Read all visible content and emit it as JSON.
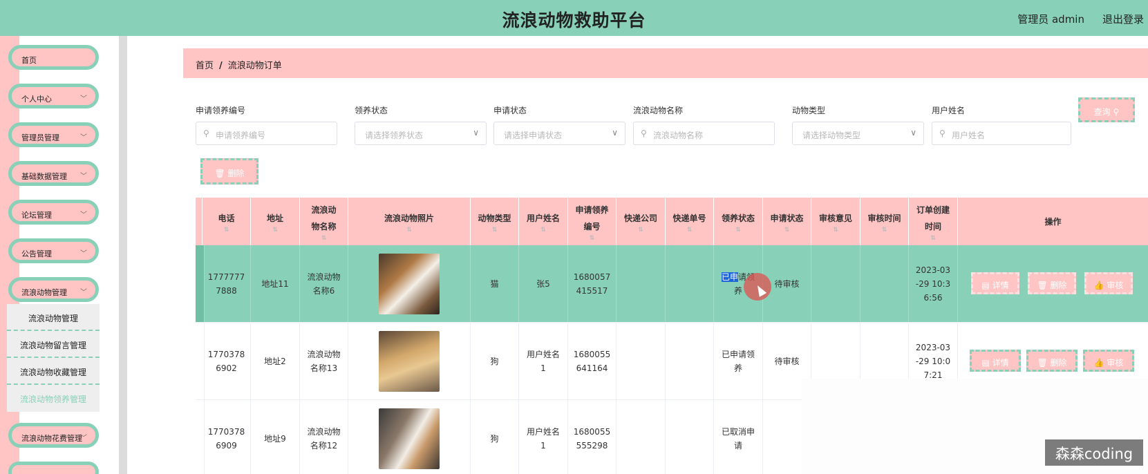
{
  "header": {
    "title": "流浪动物救助平台",
    "admin": "管理员 admin",
    "logout": "退出登录"
  },
  "sidebar": {
    "items": [
      {
        "label": "首页"
      },
      {
        "label": "个人中心"
      },
      {
        "label": "管理员管理"
      },
      {
        "label": "基础数据管理"
      },
      {
        "label": "论坛管理"
      },
      {
        "label": "公告管理"
      },
      {
        "label": "流浪动物管理"
      },
      {
        "label": "流浪动物花费管理"
      }
    ],
    "submenu": [
      "流浪动物管理",
      "流浪动物留言管理",
      "流浪动物收藏管理",
      "流浪动物领养管理"
    ]
  },
  "breadcrumb": {
    "home": "首页",
    "sep": "/",
    "current": "流浪动物订单"
  },
  "search": {
    "fields": [
      {
        "label": "申请领养编号",
        "placeholder": "申请领养编号"
      },
      {
        "label": "领养状态",
        "placeholder": "请选择领养状态"
      },
      {
        "label": "申请状态",
        "placeholder": "请选择申请状态"
      },
      {
        "label": "流浪动物名称",
        "placeholder": "流浪动物名称"
      },
      {
        "label": "动物类型",
        "placeholder": "请选择动物类型"
      },
      {
        "label": "用户姓名",
        "placeholder": "用户姓名"
      }
    ],
    "query": "查询",
    "delete": "删除"
  },
  "table": {
    "headers": [
      "电话",
      "地址",
      "流浪动物名称",
      "流浪动物照片",
      "动物类型",
      "用户姓名",
      "申请领养编号",
      "快递公司",
      "快递单号",
      "领养状态",
      "申请状态",
      "审核意见",
      "审核时间",
      "订单创建时间",
      "操作"
    ],
    "rows": [
      {
        "phone": "17777777888",
        "address": "地址11",
        "name": "流浪动物名称6",
        "type": "猫",
        "user": "张5",
        "code": "1680057415517",
        "adopt_hl": "已申",
        "adopt_rest": "请领养",
        "apply": "待审核",
        "created": "2023-03-29 10:36:56",
        "photo_color": "#a77a4b"
      },
      {
        "phone": "17703786902",
        "address": "地址2",
        "name": "流浪动物名称13",
        "type": "狗",
        "user": "用户姓名1",
        "code": "1680055641164",
        "adopt": "已申请领养",
        "apply": "待审核",
        "created": "2023-03-29 10:07:21",
        "photo_color": "#c79a5a"
      },
      {
        "phone": "17703786909",
        "address": "地址9",
        "name": "流浪动物名称12",
        "type": "狗",
        "user": "用户姓名1",
        "code": "1680055555298",
        "adopt": "已取消申请",
        "apply": "",
        "created": "",
        "photo_color": "#7d6f65"
      }
    ],
    "ops": {
      "detail": "详情",
      "delete": "删除",
      "audit": "审核"
    }
  },
  "watermark": "森森coding"
}
